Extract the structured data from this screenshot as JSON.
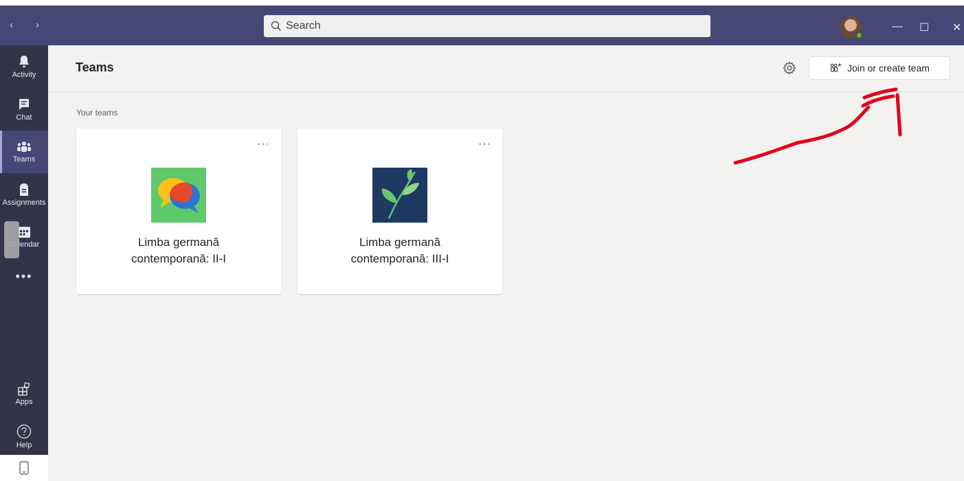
{
  "search": {
    "placeholder": "Search"
  },
  "window": {
    "minimize": "—",
    "maximize": "☐",
    "close": "✕"
  },
  "rail": {
    "items": [
      {
        "label": "Activity",
        "icon": "bell-icon"
      },
      {
        "label": "Chat",
        "icon": "chat-icon"
      },
      {
        "label": "Teams",
        "icon": "teams-icon",
        "active": true
      },
      {
        "label": "Assignments",
        "icon": "assignments-icon"
      },
      {
        "label": "Calendar",
        "icon": "calendar-icon"
      },
      {
        "label": "Apps",
        "icon": "apps-icon"
      },
      {
        "label": "Help",
        "icon": "help-icon"
      }
    ],
    "more": "•••"
  },
  "header": {
    "title": "Teams",
    "join_button_label": "Join or create team"
  },
  "section": {
    "label": "Your teams"
  },
  "teams": [
    {
      "name_line1": "Limba germană",
      "name_line2": "contemporană: II-I",
      "more": "···",
      "logo": "chat-bubbles-logo"
    },
    {
      "name_line1": "Limba germană",
      "name_line2": "contemporană: III-I",
      "more": "···",
      "logo": "leaf-logo"
    }
  ],
  "colors": {
    "topbar": "#464775",
    "rail": "#33344a",
    "accent": "#6264a7",
    "annotation": "#e3001b"
  }
}
